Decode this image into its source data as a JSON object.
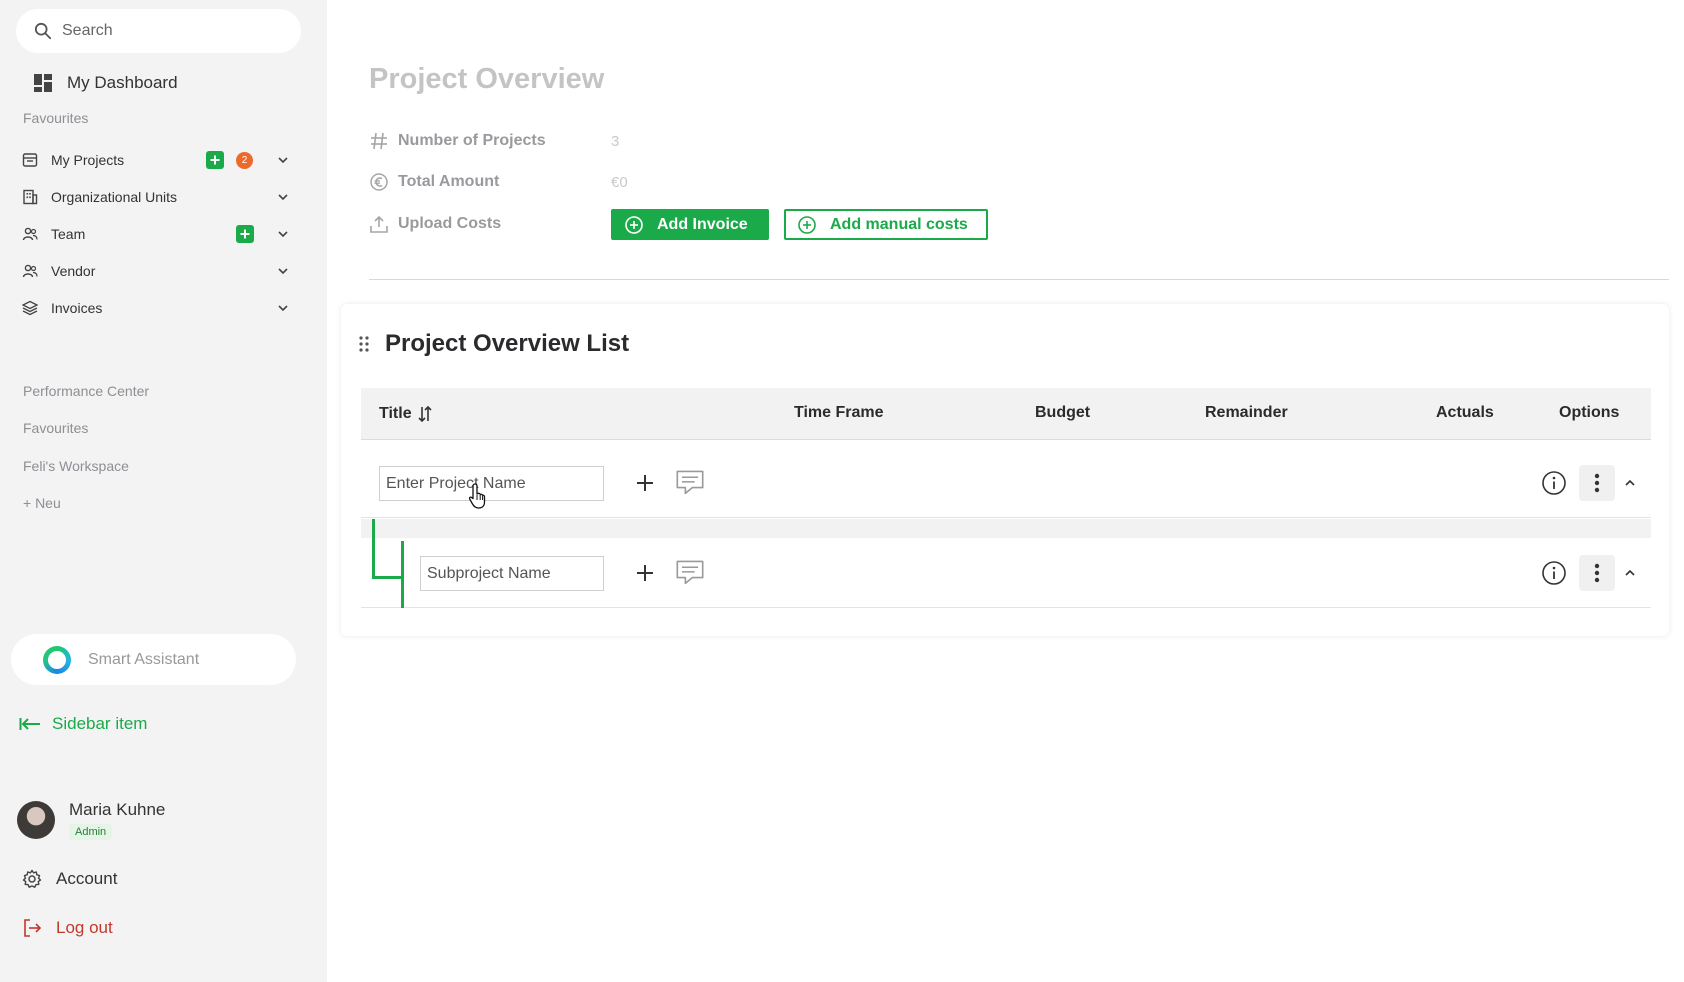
{
  "sidebar": {
    "search_placeholder": "Search",
    "dashboard_label": "My Dashboard",
    "favourites_label": "Favourites",
    "nav_items": [
      {
        "label": "My Projects",
        "icon": "projects-icon",
        "has_add": true,
        "badge": "2"
      },
      {
        "label": "Organizational Units",
        "icon": "building-icon",
        "has_add": false,
        "badge": null
      },
      {
        "label": "Team",
        "icon": "team-icon",
        "has_add": true,
        "badge": null
      },
      {
        "label": "Vendor",
        "icon": "vendor-icon",
        "has_add": false,
        "badge": null
      },
      {
        "label": "Invoices",
        "icon": "layers-icon",
        "has_add": false,
        "badge": null
      }
    ],
    "links": [
      "Performance Center",
      "Favourites",
      "Feli's Workspace",
      "+ Neu"
    ],
    "assistant_label": "Smart Assistant",
    "sidebar_item_label": "Sidebar item",
    "user": {
      "name": "Maria Kuhne",
      "role": "Admin"
    },
    "account_label": "Account",
    "logout_label": "Log out"
  },
  "main": {
    "title": "Project Overview",
    "stats": [
      {
        "label": "Number of Projects",
        "value": "3",
        "icon": "hash-icon"
      },
      {
        "label": "Total Amount",
        "value": "€0",
        "icon": "euro-icon"
      },
      {
        "label": "Upload Costs",
        "value": "",
        "icon": "upload-icon"
      }
    ],
    "add_invoice_label": "Add Invoice",
    "add_manual_costs_label": "Add manual costs",
    "list": {
      "title": "Project Overview List",
      "columns": [
        "Title",
        "Time Frame",
        "Budget",
        "Remainder",
        "Actuals",
        "Options"
      ],
      "project_placeholder": "Enter Project Name",
      "subproject_placeholder": "Subproject Name"
    }
  },
  "colors": {
    "accent": "#1aaa4a",
    "badge": "#ee6a2b",
    "logout": "#c0392b",
    "sidebar_bg": "#f3f3f4"
  }
}
